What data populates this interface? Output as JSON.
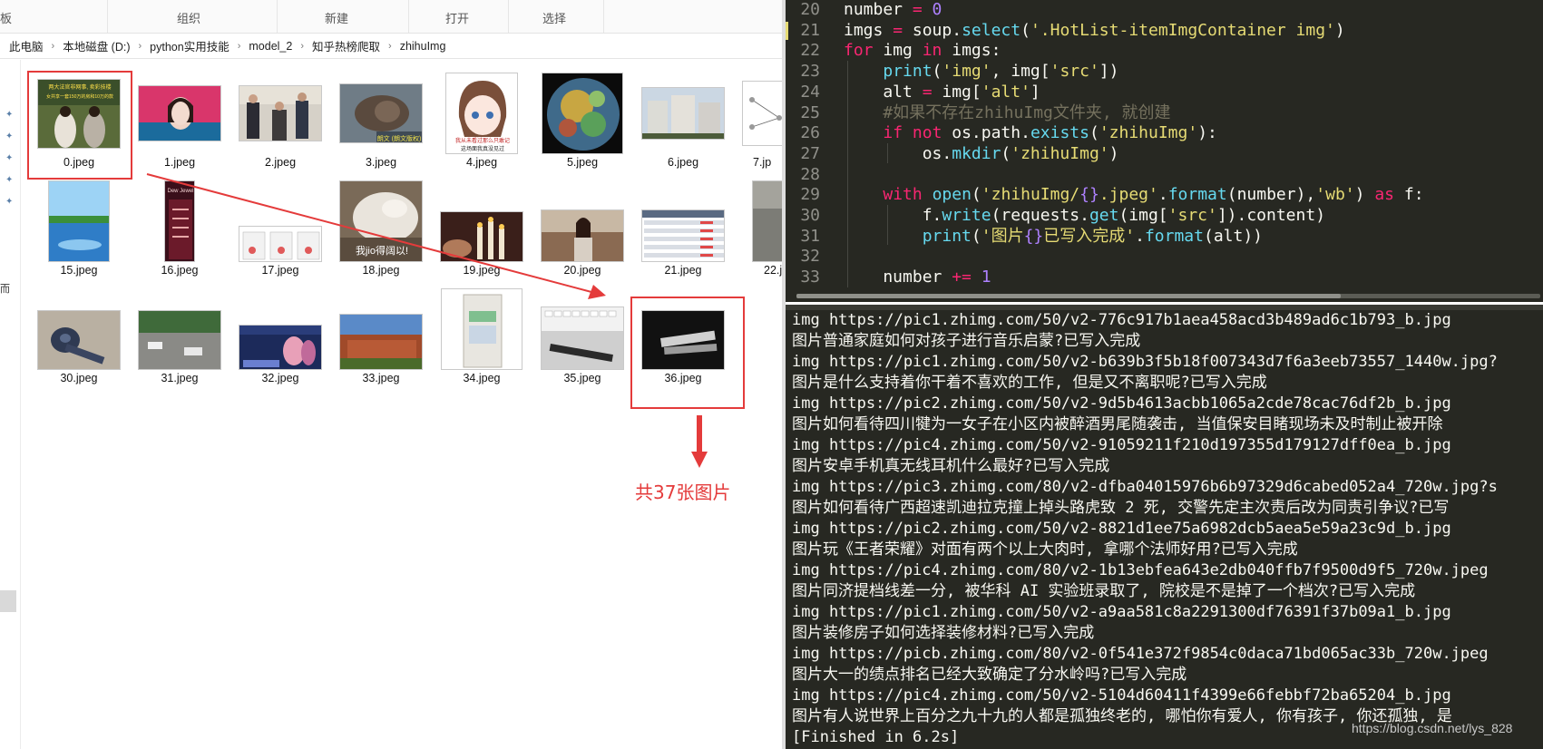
{
  "explorer": {
    "ribbon": {
      "group_cut": "板",
      "group_org": "组织",
      "group_new": "新建",
      "group_open": "打开",
      "group_select": "选择"
    },
    "breadcrumb": [
      "此电脑",
      "本地磁盘 (D:)",
      "python实用技能",
      "model_2",
      "知乎热榜爬取",
      "zhihuImg"
    ],
    "breadcrumb_sep": "›",
    "leftnav_clip": "而",
    "files": [
      {
        "name": "0.jpeg"
      },
      {
        "name": "1.jpeg"
      },
      {
        "name": "2.jpeg"
      },
      {
        "name": "3.jpeg"
      },
      {
        "name": "4.jpeg"
      },
      {
        "name": "5.jpeg"
      },
      {
        "name": "6.jpeg"
      },
      {
        "name": "7.jp"
      },
      {
        "name": "15.jpeg"
      },
      {
        "name": "16.jpeg"
      },
      {
        "name": "17.jpeg"
      },
      {
        "name": "18.jpeg"
      },
      {
        "name": "19.jpeg"
      },
      {
        "name": "20.jpeg"
      },
      {
        "name": "21.jpeg"
      },
      {
        "name": "22.j"
      },
      {
        "name": "30.jpeg"
      },
      {
        "name": "31.jpeg"
      },
      {
        "name": "32.jpeg"
      },
      {
        "name": "33.jpeg"
      },
      {
        "name": "34.jpeg"
      },
      {
        "name": "35.jpeg"
      },
      {
        "name": "36.jpeg"
      }
    ],
    "thumb_text": {
      "t0": "两大法官非网事, 卖彩技楼",
      "t0b": "女共享一套150万的房和10万的款",
      "t3": "朗文 (朗文版权)",
      "t4a": "我从未看过那么只敢记",
      "t4b": "这场面我真没见过",
      "t16": "Dew Jewel",
      "t18": "我jio得阔以!"
    },
    "annotation": "共37张图片",
    "accent_red": "#e43b3b"
  },
  "editor": {
    "lines": [
      {
        "num": "20"
      },
      {
        "num": "21"
      },
      {
        "num": "22"
      },
      {
        "num": "23"
      },
      {
        "num": "24"
      },
      {
        "num": "25"
      },
      {
        "num": "26"
      },
      {
        "num": "27"
      },
      {
        "num": "28"
      },
      {
        "num": "29"
      },
      {
        "num": "30"
      },
      {
        "num": "31"
      },
      {
        "num": "32"
      },
      {
        "num": "33"
      }
    ],
    "tok": {
      "l20": [
        "number",
        " = ",
        "0"
      ],
      "l21": [
        "imgs",
        " = ",
        "soup",
        ".",
        "select",
        "(",
        "'.HotList-itemImgContainer img'",
        ")"
      ],
      "l22": [
        "for",
        " img ",
        "in",
        " imgs:"
      ],
      "l23": [
        "    ",
        "print",
        "(",
        "'img'",
        ", img[",
        "'src'",
        "])"
      ],
      "l24": [
        "    alt ",
        "=",
        " img[",
        "'alt'",
        "]"
      ],
      "l25": [
        "    #如果不存在zhihuImg文件夹, 就创建"
      ],
      "l26": [
        "    ",
        "if",
        " ",
        "not",
        " os.path.",
        "exists",
        "(",
        "'zhihuImg'",
        "):"
      ],
      "l27": [
        "        os.",
        "mkdir",
        "(",
        "'zhihuImg'",
        ")"
      ],
      "l29": [
        "    ",
        "with",
        " ",
        "open",
        "(",
        "'zhihuImg/",
        "{}",
        ".jpeg'",
        ".",
        "format",
        "(number),",
        "'wb'",
        ") ",
        "as",
        " f:"
      ],
      "l30": [
        "        f.",
        "write",
        "(requests.",
        "get",
        "(img[",
        "'src'",
        "]).content)"
      ],
      "l31": [
        "        ",
        "print",
        "(",
        "'图片",
        "{}",
        "已写入完成'",
        ".",
        "format",
        "(alt))"
      ],
      "l33": [
        "    number ",
        "+=",
        " ",
        "1"
      ]
    },
    "colors": {
      "bg": "#272822",
      "keyword": "#f92672",
      "string": "#e6db74",
      "func": "#66d9ef",
      "number": "#ae81ff",
      "comment": "#75715e"
    }
  },
  "console": {
    "lines": [
      "img https://pic1.zhimg.com/50/v2-776c917b1aea458acd3b489ad6c1b793_b.jpg",
      "图片普通家庭如何对孩子进行音乐启蒙?已写入完成",
      "img https://pic1.zhimg.com/50/v2-b639b3f5b18f007343d7f6a3eeb73557_1440w.jpg?",
      "图片是什么支持着你干着不喜欢的工作, 但是又不离职呢?已写入完成",
      "img https://pic2.zhimg.com/50/v2-9d5b4613acbb1065a2cde78cac76df2b_b.jpg",
      "图片如何看待四川犍为一女子在小区内被醉酒男尾随袭击, 当值保安目睹现场未及时制止被开除",
      "img https://pic4.zhimg.com/50/v2-91059211f210d197355d179127dff0ea_b.jpg",
      "图片安卓手机真无线耳机什么最好?已写入完成",
      "img https://pic3.zhimg.com/80/v2-dfba04015976b6b97329d6cabed052a4_720w.jpg?s",
      "图片如何看待广西超速凯迪拉克撞上掉头路虎致 2 死, 交警先定主次责后改为同责引争议?已写",
      "img https://pic2.zhimg.com/50/v2-8821d1ee75a6982dcb5aea5e59a23c9d_b.jpg",
      "图片玩《王者荣耀》对面有两个以上大肉时, 拿哪个法师好用?已写入完成",
      "img https://pic4.zhimg.com/80/v2-1b13ebfea643e2db040ffb7f9500d9f5_720w.jpeg",
      "图片同济提档线差一分, 被华科 AI 实验班录取了, 院校是不是掉了一个档次?已写入完成",
      "img https://pic1.zhimg.com/50/v2-a9aa581c8a2291300df76391f37b09a1_b.jpg",
      "图片装修房子如何选择装修材料?已写入完成",
      "img https://picb.zhimg.com/80/v2-0f541e372f9854c0daca71bd065ac33b_720w.jpeg",
      "图片大一的绩点排名已经大致确定了分水岭吗?已写入完成",
      "img https://pic4.zhimg.com/50/v2-5104d60411f4399e66febbf72ba65204_b.jpg",
      "图片有人说世界上百分之九十九的人都是孤独终老的, 哪怕你有爱人, 你有孩子, 你还孤独, 是",
      "[Finished in 6.2s]"
    ],
    "watermark": "https://blog.csdn.net/lys_828"
  }
}
